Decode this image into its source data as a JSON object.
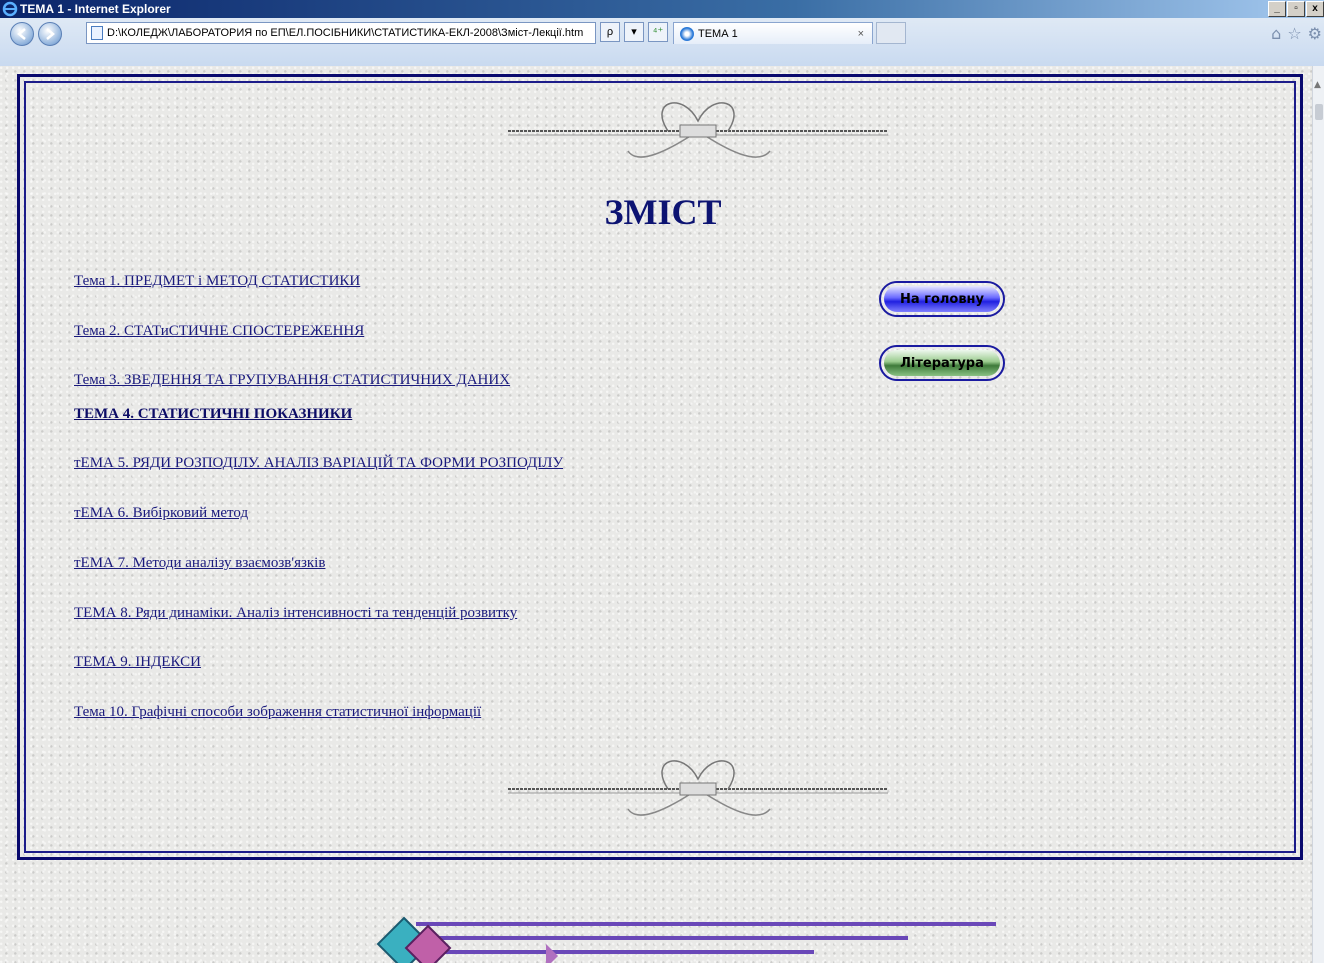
{
  "window": {
    "title": "ТЕМА 1 - Internet Explorer",
    "controls": [
      "_",
      "▫",
      "x"
    ]
  },
  "navbar": {
    "address": "D:\\КОЛЕДЖ\\ЛАБОРАТОРИЯ по ЕП\\ЕЛ.ПОСІБНИКИ\\СТАТИСТИКА-ЕКЛ-2008\\Зміст-Лекції.htm",
    "search_symbol": "ρ",
    "dropdown_symbol": "▾",
    "refresh_symbol": "⁴⁺",
    "tab_title": "ТЕМА 1",
    "tab_close": "×",
    "right_icons": [
      "⌂",
      "☆",
      "⚙"
    ]
  },
  "page": {
    "heading": "ЗМІСТ",
    "toc": [
      {
        "label": "Тема 1. ПРЕДМЕТ і МЕТОД СТАТИСТИКИ",
        "bold": false
      },
      {
        "label": "Тема 2. СТАТиСТИЧНЕ СПОСТЕРЕЖЕННЯ",
        "bold": false
      },
      {
        "label": "Тема 3. ЗВЕДЕННЯ ТА ГРУПУВАННЯ СТАТИСТИЧНИХ ДАНИХ",
        "bold": false
      },
      {
        "label": "ТЕМА 4. СТАТИСТИЧНІ ПОКАЗНИКИ",
        "bold": true
      },
      {
        "label": "тЕМА 5. РЯДИ РОЗПОДІЛУ. АНАЛІЗ ВАРІАЦІЙ ТА ФОРМИ РОЗПОДІЛУ",
        "bold": false
      },
      {
        "label": "тЕМА 6. Вибірковий метод",
        "bold": false
      },
      {
        "label": "тЕМА 7. Методи аналізу взаємозв'язків",
        "bold": false
      },
      {
        "label": "ТЕМА 8. Ряди динаміки. Аналіз інтенсивності та тенденцій розвитку",
        "bold": false
      },
      {
        "label": "ТЕМА 9. ІНДЕКСИ",
        "bold": false
      },
      {
        "label": "Тема 10. Графічні способи зображення статистичної інформації",
        "bold": false
      }
    ],
    "buttons": {
      "home": "На головну",
      "literature": "Література"
    }
  },
  "colors": {
    "link": "#1a1a7d",
    "heading": "#0c1372",
    "frame": "#0a0a6e"
  }
}
